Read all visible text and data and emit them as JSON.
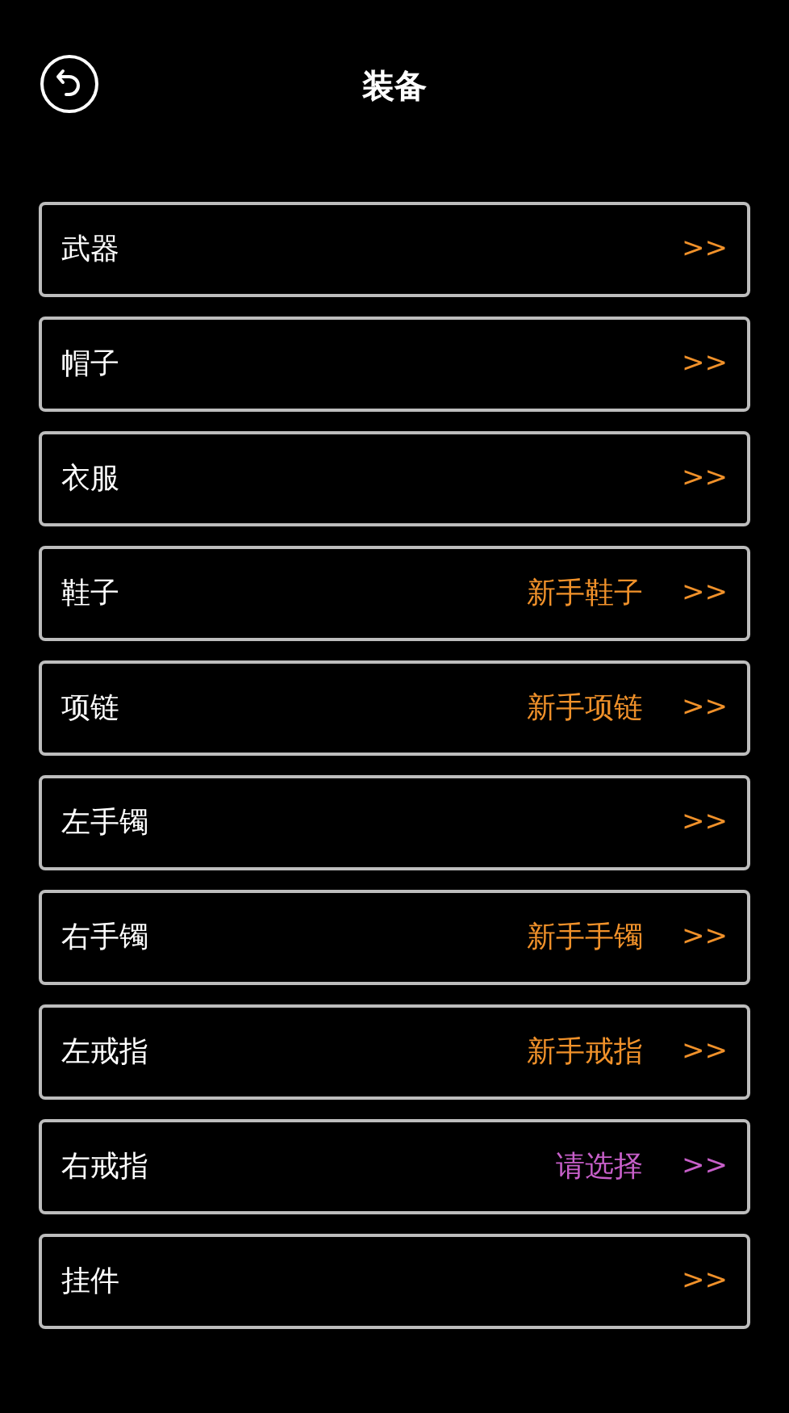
{
  "header": {
    "title": "装备"
  },
  "slots": [
    {
      "label": "武器",
      "arrow": ">>",
      "color": "#f0912a"
    },
    {
      "label": "帽子",
      "arrow": ">>",
      "color": "#f0912a"
    },
    {
      "label": "衣服",
      "arrow": ">>",
      "color": "#f0912a"
    },
    {
      "label": "鞋子",
      "value": "新手鞋子",
      "arrow": ">>",
      "color": "#f0912a"
    },
    {
      "label": "项链",
      "value": "新手项链",
      "arrow": ">>",
      "color": "#f0912a"
    },
    {
      "label": "左手镯",
      "arrow": ">>",
      "color": "#f0912a"
    },
    {
      "label": "右手镯",
      "value": "新手手镯",
      "arrow": ">>",
      "color": "#f0912a"
    },
    {
      "label": "左戒指",
      "value": "新手戒指",
      "arrow": ">>",
      "color": "#f0912a"
    },
    {
      "label": "右戒指",
      "value": "请选择",
      "arrow": ">>",
      "color": "#c75fc9"
    },
    {
      "label": "挂件",
      "arrow": ">>",
      "color": "#f0912a"
    }
  ]
}
